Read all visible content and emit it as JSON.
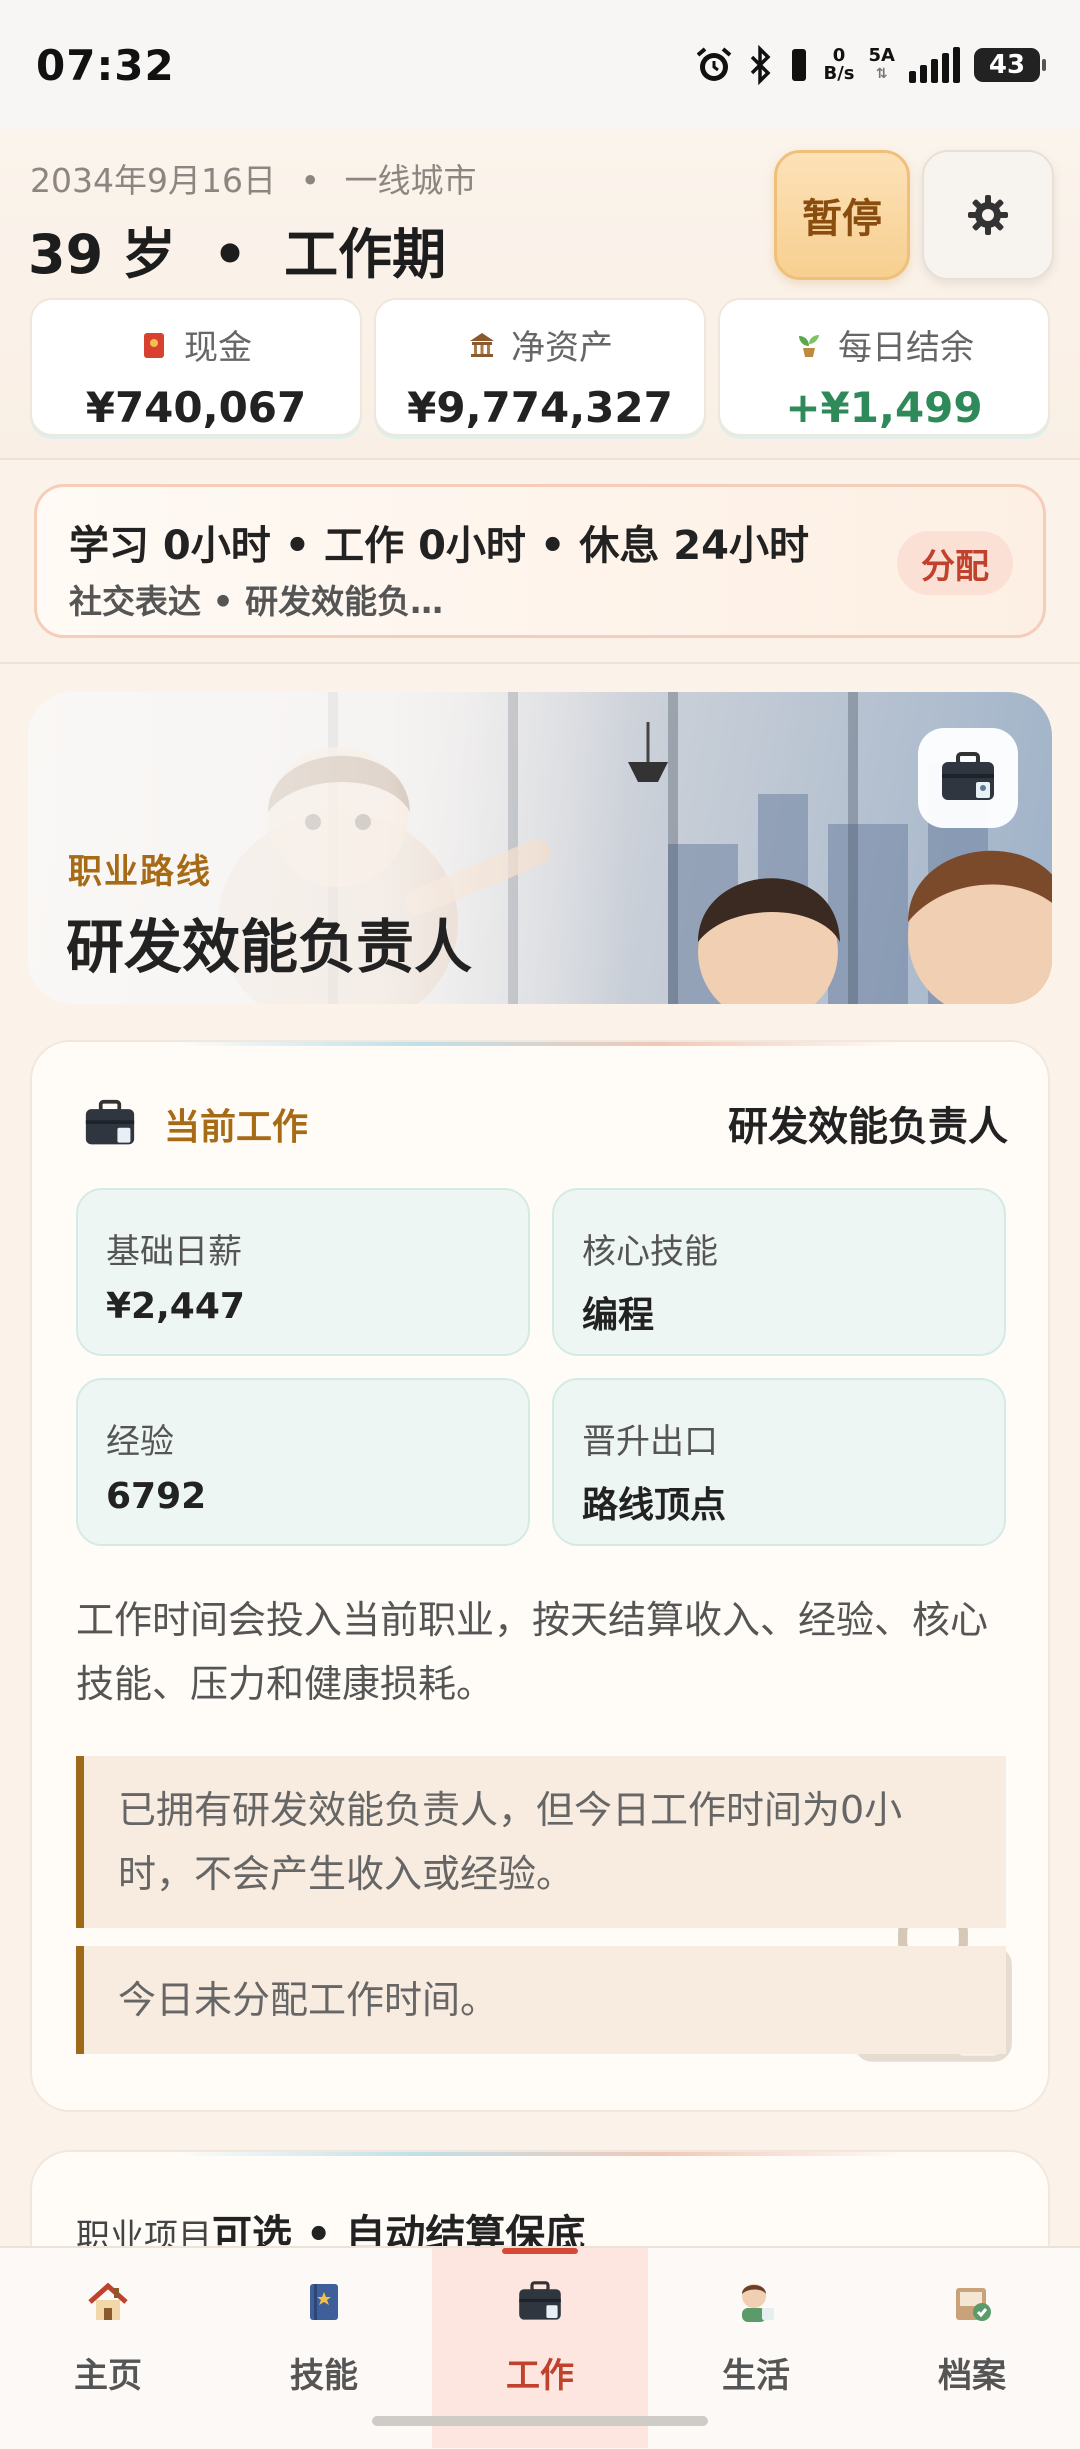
{
  "status_bar": {
    "time": "07:32",
    "net_speed_top": "0",
    "net_speed_bottom": "B/s",
    "network_type": "5A",
    "battery": "43",
    "icons": [
      "alarm-icon",
      "bluetooth-icon",
      "vibrate-icon",
      "signal-icon",
      "battery-icon"
    ]
  },
  "header": {
    "date": "2034年9月16日",
    "city": "一线城市",
    "date_separator": "•",
    "age": "39 岁",
    "phase": "工作期",
    "age_separator": "•",
    "pause_label": "暂停",
    "settings_icon": "gear-icon"
  },
  "stats": [
    {
      "label": "现金",
      "value": "¥740,067",
      "icon": "red-envelope-icon"
    },
    {
      "label": "净资产",
      "value": "¥9,774,327",
      "icon": "bank-icon"
    },
    {
      "label": "每日结余",
      "value": "+¥1,499",
      "icon": "sprout-icon"
    }
  ],
  "allocation": {
    "line1": "学习 0小时 • 工作 0小时 • 休息 24小时",
    "line2": "社交表达 • 研发效能负…",
    "button": "分配"
  },
  "career_banner": {
    "label": "职业路线",
    "title": "研发效能负责人",
    "icon": "briefcase-icon"
  },
  "current_job": {
    "header_label": "当前工作",
    "header_value": "研发效能负责人",
    "fields": [
      {
        "key": "基础日薪",
        "value": "¥2,447"
      },
      {
        "key": "核心技能",
        "value": "编程"
      },
      {
        "key": "经验",
        "value": "6792"
      },
      {
        "key": "晋升出口",
        "value": "路线顶点"
      }
    ],
    "description": "工作时间会投入当前职业，按天结算收入、经验、核心技能、压力和健康损耗。",
    "notes": [
      "已拥有研发效能负责人，但今日工作时间为0小时，不会产生收入或经验。",
      "今日未分配工作时间。"
    ]
  },
  "projects": {
    "label": "职业项目",
    "value": "可选 • 自动结算保底"
  },
  "tabs": [
    {
      "label": "主页",
      "icon": "house-icon"
    },
    {
      "label": "技能",
      "icon": "book-icon"
    },
    {
      "label": "工作",
      "icon": "briefcase-icon"
    },
    {
      "label": "生活",
      "icon": "person-icon"
    },
    {
      "label": "档案",
      "icon": "archive-icon"
    }
  ],
  "active_tab": "工作",
  "colors": {
    "accent_gold": "#a76b16",
    "accent_red": "#c0412c",
    "positive_green": "#2f8a5a",
    "background": "#fbf3ea"
  }
}
